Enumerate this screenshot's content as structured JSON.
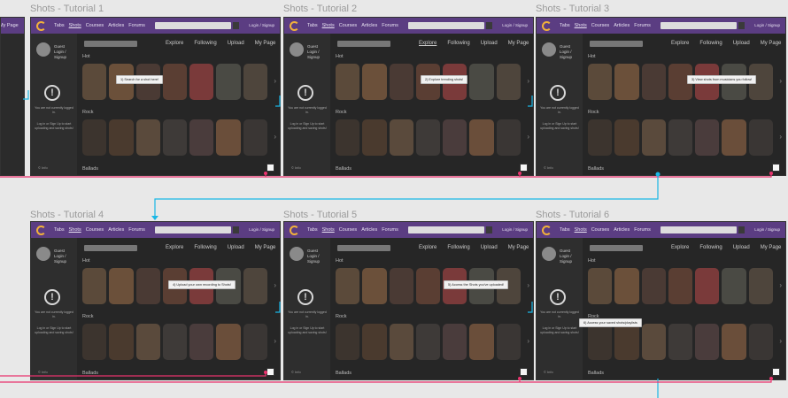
{
  "frames": [
    {
      "title": "Shots - Tutorial 1",
      "tooltip": "1) Search for a shot here!"
    },
    {
      "title": "Shots - Tutorial 2",
      "tooltip": "2) Explore trending shots!"
    },
    {
      "title": "Shots - Tutorial 3",
      "tooltip": "3) View shots from musicians you follow!"
    },
    {
      "title": "Shots - Tutorial 4",
      "tooltip": "4) Upload your own recording to Shots!"
    },
    {
      "title": "Shots - Tutorial 5",
      "tooltip": "5) Access the Shots you've uploaded!"
    },
    {
      "title": "Shots - Tutorial 6",
      "tooltip": "6) Access your saved shots/playlists"
    }
  ],
  "nav": {
    "items": [
      "Tabs",
      "Shots",
      "Courses",
      "Articles",
      "Forums"
    ],
    "user": "Login / Signup"
  },
  "tabs": [
    "Explore",
    "Following",
    "Upload",
    "My Page"
  ],
  "sections": {
    "hot": "Hot",
    "rock": "Rock",
    "ballads": "Ballads"
  },
  "left_panel": {
    "guest": "Guest",
    "guest_sub": "Login / Signup",
    "login_msg": "You are not currently logged in.",
    "login_note": "Log in or Sign Up to start uploading and saving shots!",
    "bottom": "© Info"
  },
  "colors": {
    "accent": "#5b3d82",
    "logo": "#f2b23a",
    "link_pink": "#e8336d",
    "link_cyan": "#19b7e6",
    "canvas": "#e8e8e8"
  }
}
